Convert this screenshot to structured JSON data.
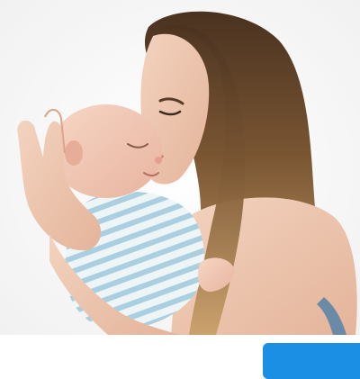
{
  "photo": {
    "subject": "woman-kissing-newborn-baby",
    "alt": ""
  },
  "bottom_bar": {
    "text": "",
    "button_label": "",
    "button_color": "#1a8fe3"
  }
}
